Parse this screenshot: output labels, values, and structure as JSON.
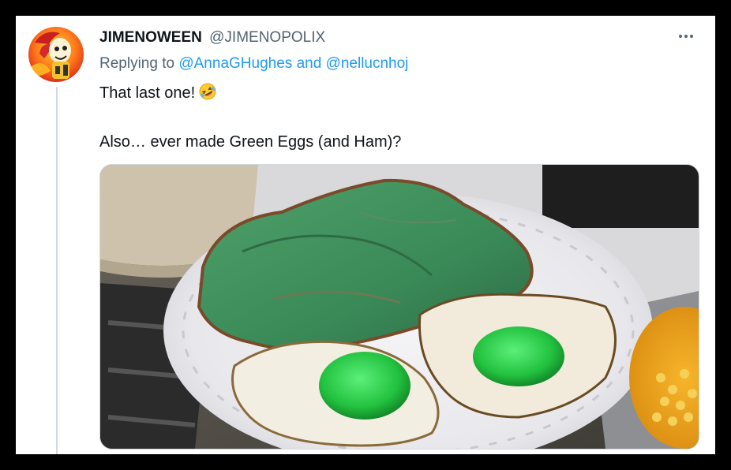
{
  "tweet": {
    "display_name": "JIMENOWEEN",
    "handle": "@JIMENOPOLIX",
    "replying_prefix": "Replying to",
    "mention_1": "@AnnaGHughes",
    "replying_and": "and",
    "mention_2": "@nellucnhoj",
    "line_1": "That last one!",
    "line_1_emoji": "rolling-on-floor-laughing-icon",
    "line_2": "Also… ever made Green Eggs (and Ham)?"
  },
  "colors": {
    "link": "#1d9bf0",
    "secondary_text": "#536471",
    "primary_text": "#0f1419"
  }
}
